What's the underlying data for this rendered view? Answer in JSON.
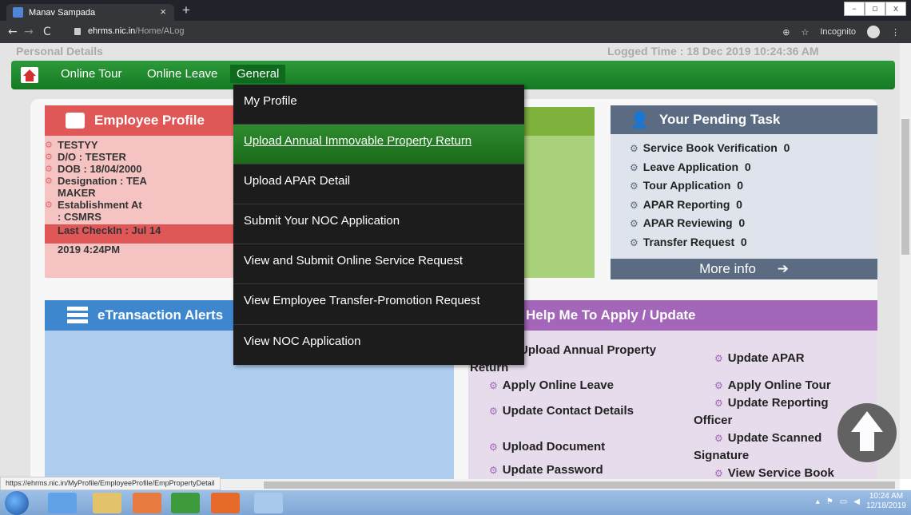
{
  "browser": {
    "tab_title": "Manav Sampada",
    "tab_close": "×",
    "new_tab": "+",
    "url_host": "ehrms.nic.in",
    "url_path": "/Home/ALog",
    "incognito_label": "Incognito",
    "win_minimize": "–",
    "win_restore": "▫",
    "win_close": "x"
  },
  "top_strip": {
    "left_text": "Personal Details",
    "right_text": "Logged Time : 18 Dec 2019 10:24:36 AM"
  },
  "navbar": {
    "items": [
      "Online Tour",
      "Online Leave",
      "General"
    ]
  },
  "dropdown": {
    "items": [
      "My Profile",
      "Upload Annual Immovable Property Return",
      "Upload APAR Detail",
      "Submit Your NOC Application",
      "View and Submit Online Service Request",
      "View Employee Transfer-Promotion Request",
      "View NOC Application"
    ],
    "highlighted_index": 1
  },
  "employee_profile": {
    "title": "Employee Profile",
    "name": "TESTYY",
    "do": "D/O : TESTER",
    "dob": "DOB : 18/04/2000",
    "designation_1": "Designation : TEA",
    "designation_2": "MAKER",
    "establishment_1": "Establishment At",
    "establishment_2": ": CSMRS",
    "checkin_1": "Last CheckIn : Jul 14",
    "checkin_2": "2019 4:24PM"
  },
  "pending_task": {
    "title": "Your Pending Task",
    "items": [
      {
        "label": "Service Book Verification",
        "count": "0"
      },
      {
        "label": "Leave Application",
        "count": "0"
      },
      {
        "label": "Tour Application",
        "count": "0"
      },
      {
        "label": "APAR Reporting",
        "count": "0"
      },
      {
        "label": "APAR Reviewing",
        "count": "0"
      },
      {
        "label": "Transfer Request",
        "count": "0"
      }
    ],
    "more_info": "More info"
  },
  "etransaction": {
    "title": "eTransaction Alerts"
  },
  "help": {
    "title": "Help Me To Apply / Update",
    "upload_annual_1": "Upload Annual Property",
    "upload_annual_2": "Return",
    "apply_leave": "Apply Online Leave",
    "update_contact": "Update Contact Details",
    "upload_document": "Upload Document",
    "update_password": "Update Password",
    "update_apar": "Update APAR",
    "apply_tour": "Apply Online Tour",
    "update_reporting_1": "Update Reporting",
    "update_reporting_2": "Officer",
    "update_signature_1": "Update Scanned",
    "update_signature_2": "Signature",
    "view_service_book": "View Service Book"
  },
  "status_url": "https://ehrms.nic.in/MyProfile/EmployeeProfile/EmpPropertyDetail",
  "tray": {
    "time": "10:24 AM",
    "date": "12/18/2019"
  },
  "colors": {
    "navbar_green": "#157a23",
    "profile_red": "#e05757",
    "pending_slate": "#5b6b82",
    "etx_blue": "#3e87cf",
    "help_purple": "#a366b8"
  }
}
